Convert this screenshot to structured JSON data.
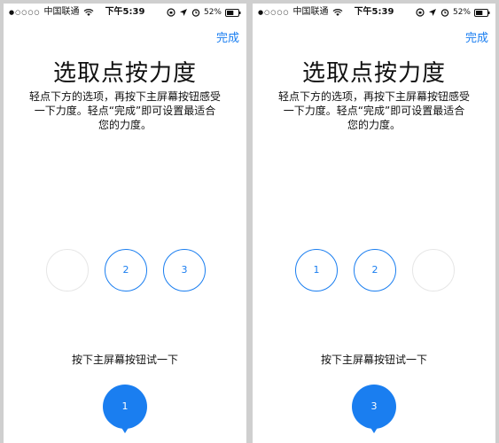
{
  "colors": {
    "accent": "#1a7ef0",
    "background": "#cfcfcf",
    "empty_circle_border": "#e6e6e6"
  },
  "screens": [
    {
      "status_bar": {
        "carrier": "中国联通",
        "signal_glyph": "●○○○○",
        "time": "下午5:39",
        "battery": "52%"
      },
      "done_label": "完成",
      "title": "选取点按力度",
      "instructions": "轻点下方的选项，再按下主屏幕按钮感受\n一下力度。轻点“完成”即可设置最适合\n您的力度。",
      "options": [
        "",
        "2",
        "3"
      ],
      "prompt": "按下主屏幕按钮试一下",
      "selected_option": "1"
    },
    {
      "status_bar": {
        "carrier": "中国联通",
        "signal_glyph": "●○○○○",
        "time": "下午5:39",
        "battery": "52%"
      },
      "done_label": "完成",
      "title": "选取点按力度",
      "instructions": "轻点下方的选项，再按下主屏幕按钮感受\n一下力度。轻点“完成”即可设置最适合\n您的力度。",
      "options": [
        "1",
        "2",
        ""
      ],
      "prompt": "按下主屏幕按钮试一下",
      "selected_option": "3"
    }
  ]
}
